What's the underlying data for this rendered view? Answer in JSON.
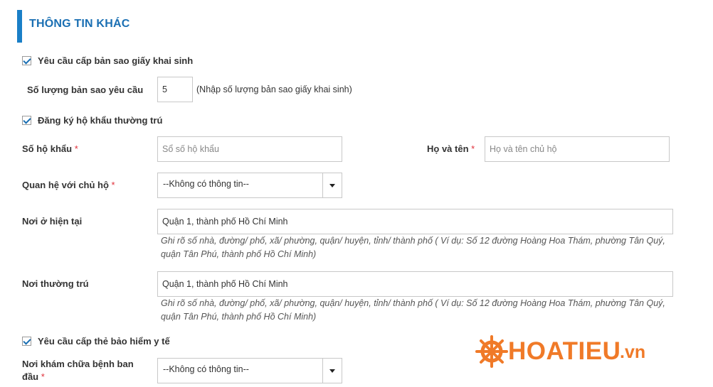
{
  "section": {
    "title": "THÔNG TIN KHÁC"
  },
  "birth_cert": {
    "checkbox_label": "Yêu cầu cấp bản sao giấy khai sinh",
    "checked": true,
    "copies_label": "Số lượng bản sao yêu cầu",
    "copies_value": "5",
    "copies_note": "(Nhập số lượng bản sao giấy khai sinh)"
  },
  "household": {
    "checkbox_label": "Đăng ký hộ khẩu thường trú",
    "checked": true,
    "book_no_label": "Số hộ khẩu",
    "book_no_placeholder": "Sổ số hộ khẩu",
    "head_name_label": "Họ và tên",
    "head_name_placeholder": "Họ và tên chủ hộ",
    "relation_label": "Quan hệ với chủ hộ",
    "relation_value": "--Không có thông tin--",
    "current_address_label": "Nơi ở hiện tại",
    "current_address_value": "Quận 1, thành phố Hồ Chí Minh",
    "current_address_hint": "Ghi rõ số nhà, đường/ phố, xã/ phường, quận/ huyện, tỉnh/ thành phố ( Ví dụ: Số 12 đường Hoàng Hoa Thám, phường Tân Quý, quận Tân Phú, thành phố Hồ Chí Minh)",
    "permanent_address_label": "Nơi thường trú",
    "permanent_address_value": "Quận 1, thành phố Hồ Chí Minh",
    "permanent_address_hint": "Ghi rõ số nhà, đường/ phố, xã/ phường, quận/ huyện, tỉnh/ thành phố ( Ví dụ: Số 12 đường Hoàng Hoa Thám, phường Tân Quý, quận Tân Phú, thành phố Hồ Chí Minh)"
  },
  "insurance": {
    "checkbox_label": "Yêu cầu cấp thẻ bảo hiểm y tế",
    "checked": true,
    "clinic_label": "Nơi khám chữa bệnh ban đầu",
    "clinic_value": "--Không có thông tin--"
  },
  "required_marker": "*",
  "watermark": {
    "text": "HOATIEU",
    "suffix": ".vn",
    "color": "#f07a28"
  },
  "colors": {
    "accent": "#1a7fc7",
    "required": "#e0303a"
  }
}
